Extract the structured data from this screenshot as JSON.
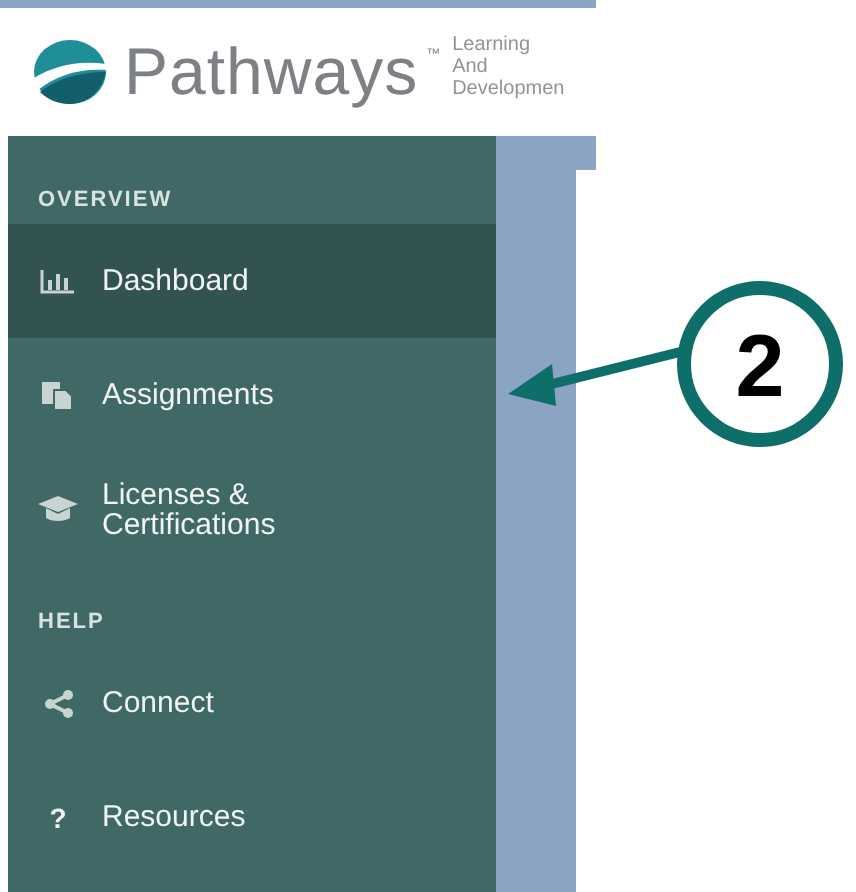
{
  "header": {
    "brand": "Pathways",
    "trademark": "™",
    "tagline": [
      "Learning",
      "And",
      "Developmen"
    ]
  },
  "sidebar": {
    "sections": [
      {
        "title": "OVERVIEW",
        "items": [
          {
            "label": "Dashboard",
            "kind": "chart",
            "selected": true
          },
          {
            "label": "Assignments",
            "kind": "docs",
            "selected": false
          },
          {
            "label": "Licenses & Certifications",
            "kind": "cap",
            "selected": false
          }
        ]
      },
      {
        "title": "HELP",
        "items": [
          {
            "label": "Connect",
            "kind": "share",
            "selected": false
          },
          {
            "label": "Resources",
            "kind": "glyph",
            "glyph": "?",
            "selected": false
          }
        ]
      }
    ]
  },
  "callout": {
    "number": "2"
  }
}
